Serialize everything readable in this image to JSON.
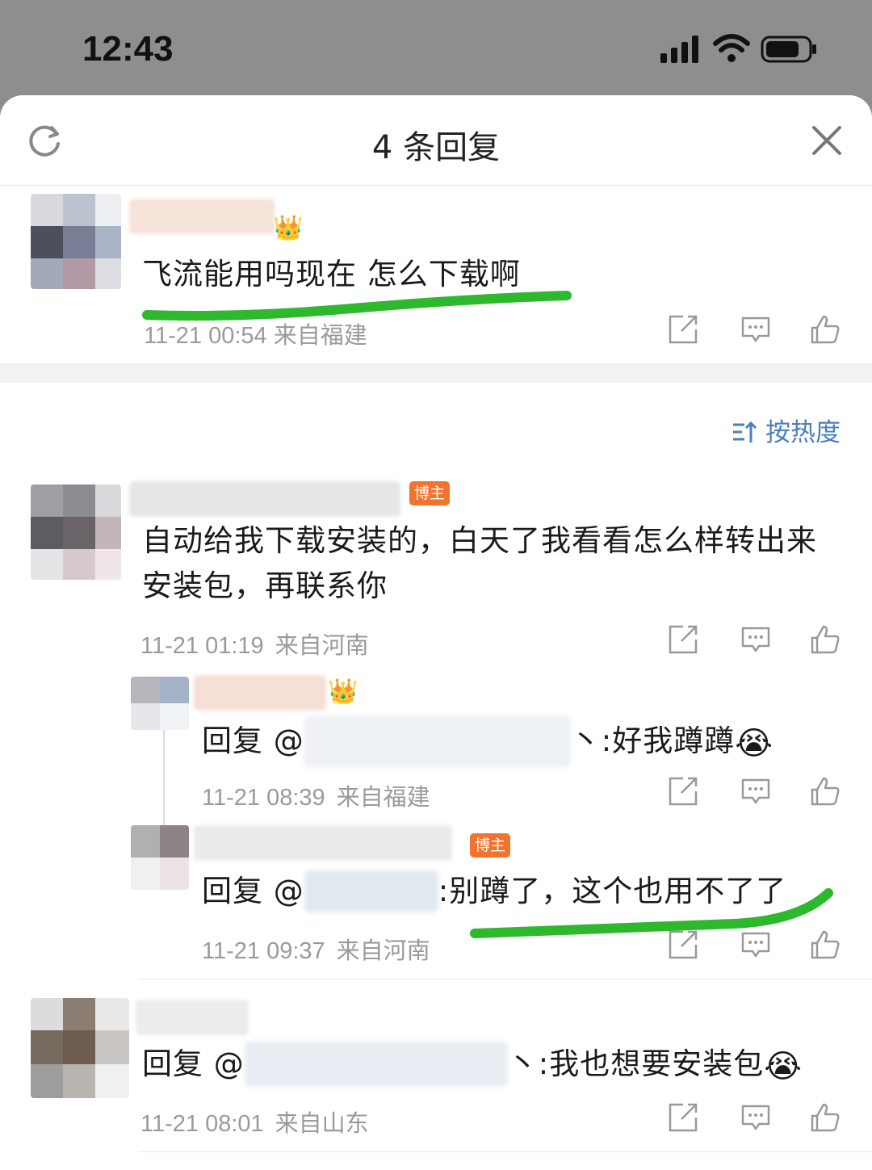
{
  "status_bar": {
    "time": "12:43"
  },
  "header": {
    "title": "4 条回复"
  },
  "main_comment": {
    "text": "飞流能用吗现在 怎么下载啊",
    "meta": "11-21 00:54 来自福建"
  },
  "sort": {
    "label": "按热度"
  },
  "replies": [
    {
      "badge": "博主",
      "text_line1": "自动给我下载安装的，白天了我看看怎么样转出来",
      "text_line2": "安装包，再联系你",
      "time": "11-21 01:19",
      "location": "来自河南"
    },
    {
      "reply_prefix": "回复 @",
      "reply_suffix": "丶:好我蹲蹲",
      "emoji": "😭",
      "time": "11-21 08:39",
      "location": "来自福建"
    },
    {
      "badge": "博主",
      "reply_prefix": "回复 @",
      "reply_suffix": ":别蹲了，这个也用不了了",
      "time": "11-21 09:37",
      "location": "来自河南"
    },
    {
      "reply_prefix": "回复 @",
      "reply_suffix": "丶:我也想要安装包",
      "emoji": "😭",
      "time": "11-21 08:01",
      "location": "来自山东"
    }
  ],
  "colors": {
    "accent": "#4a7fc1",
    "badge": "#f2732d",
    "highlight": "#2db82d"
  },
  "icons": [
    "refresh-icon",
    "close-icon",
    "share-icon",
    "comment-icon",
    "like-icon",
    "crown-icon",
    "sort-icon"
  ]
}
